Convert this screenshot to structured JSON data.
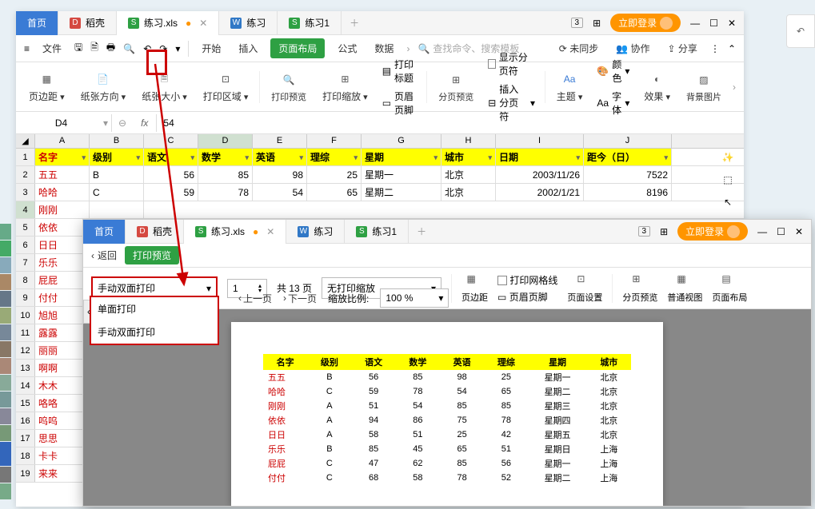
{
  "tabs": {
    "home": "首页",
    "daoke": "稻壳",
    "file1": "练习.xls",
    "file2": "练习",
    "file3": "练习1"
  },
  "login_btn": "立即登录",
  "menu": {
    "file": "文件",
    "start": "开始",
    "insert": "插入",
    "layout": "页面布局",
    "formula": "公式",
    "data": "数据",
    "search_ph": "查找命令、搜索模板",
    "unsync": "未同步",
    "collab": "协作",
    "share": "分享"
  },
  "ribbon": {
    "margins": "页边距",
    "orient": "纸张方向",
    "size": "纸张大小",
    "area": "打印区域",
    "preview": "打印预览",
    "scale": "打印缩放",
    "titles": "打印标题",
    "headfoot": "页眉页脚",
    "breaks_preview": "分页预览",
    "show_breaks": "显示分页符",
    "insert_break": "插入分页符",
    "theme": "主题",
    "color": "颜色",
    "font": "字体",
    "effect": "效果",
    "bgimg": "背景图片"
  },
  "cell": {
    "ref": "D4",
    "fx": "fx",
    "val": "54"
  },
  "cols": [
    "A",
    "B",
    "C",
    "D",
    "E",
    "F",
    "G",
    "H",
    "I",
    "J"
  ],
  "hdr": [
    "名字",
    "级别",
    "语文",
    "数学",
    "英语",
    "理综",
    "星期",
    "城市",
    "日期",
    "距今（日）"
  ],
  "rows": [
    {
      "n": "五五",
      "lv": "B",
      "c": "56",
      "d": "85",
      "e": "98",
      "f": "25",
      "w": "星期一",
      "ct": "北京",
      "dt": "2003/11/26",
      "days": "7522"
    },
    {
      "n": "哈哈",
      "lv": "C",
      "c": "59",
      "d": "78",
      "e": "54",
      "f": "65",
      "w": "星期二",
      "ct": "北京",
      "dt": "2002/1/21",
      "days": "8196"
    }
  ],
  "names_only": [
    "刚刚",
    "依依",
    "日日",
    "乐乐",
    "屁屁",
    "付付",
    "旭旭",
    "露露",
    "丽丽",
    "啊啊",
    "木木",
    "咯咯",
    "呜呜",
    "思思",
    "卡卡",
    "来来"
  ],
  "preview": {
    "back": "返回",
    "title": "打印预览",
    "duplex_sel": "手动双面打印",
    "opt_single": "单面打印",
    "opt_duplex": "手动双面打印",
    "page_num": "1",
    "total_pages": "共 13 页",
    "prev": "上一页",
    "next": "下一页",
    "noscale": "无打印缩放",
    "zoom_lbl": "缩放比例:",
    "zoom_val": "100 %",
    "margins": "页边距",
    "gridlines": "打印网格线",
    "headfoot": "页眉页脚",
    "pagesetup": "页面设置",
    "breakview": "分页预览",
    "normal": "普通视图",
    "layout": "页面布局"
  },
  "ptable": {
    "hdr": [
      "名字",
      "级别",
      "语文",
      "数学",
      "英语",
      "理综",
      "星期",
      "城市"
    ],
    "rows": [
      [
        "五五",
        "B",
        "56",
        "85",
        "98",
        "25",
        "星期一",
        "北京"
      ],
      [
        "哈哈",
        "C",
        "59",
        "78",
        "54",
        "65",
        "星期二",
        "北京"
      ],
      [
        "刚刚",
        "A",
        "51",
        "54",
        "85",
        "85",
        "星期三",
        "北京"
      ],
      [
        "依依",
        "A",
        "94",
        "86",
        "75",
        "78",
        "星期四",
        "北京"
      ],
      [
        "日日",
        "A",
        "58",
        "51",
        "25",
        "42",
        "星期五",
        "北京"
      ],
      [
        "乐乐",
        "B",
        "85",
        "45",
        "65",
        "51",
        "星期日",
        "上海"
      ],
      [
        "屁屁",
        "C",
        "47",
        "62",
        "85",
        "56",
        "星期一",
        "上海"
      ],
      [
        "付付",
        "C",
        "68",
        "58",
        "78",
        "52",
        "星期二",
        "上海"
      ]
    ]
  }
}
